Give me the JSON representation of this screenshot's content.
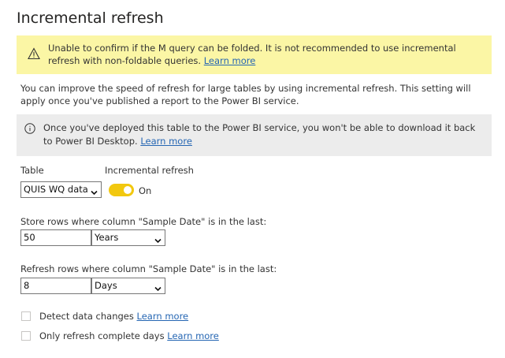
{
  "panel": {
    "title": "Incremental refresh"
  },
  "warning": {
    "text": "Unable to confirm if the M query can be folded. It is not recommended to use incremental refresh with non-foldable queries.",
    "link": "Learn more",
    "icon": "warning-icon"
  },
  "description": "You can improve the speed of refresh for large tables by using incremental refresh. This setting will apply once you've published a report to the Power BI service.",
  "info": {
    "text": "Once you've deployed this table to the Power BI service, you won't be able to download it back to Power BI Desktop.",
    "link": "Learn more",
    "icon": "info-icon"
  },
  "table": {
    "label": "Table",
    "value": "QUIS WQ data"
  },
  "incremental": {
    "label": "Incremental refresh",
    "state": "On",
    "enabled": true,
    "accent": "#f2c80f"
  },
  "store": {
    "label": "Store rows where column \"Sample Date\" is in the last:",
    "value": "50",
    "unit": "Years"
  },
  "refresh": {
    "label": "Refresh rows where column \"Sample Date\" is in the last:",
    "value": "8",
    "unit": "Days"
  },
  "detect": {
    "label": "Detect data changes",
    "link": "Learn more",
    "checked": false
  },
  "complete": {
    "label": "Only refresh complete days",
    "link": "Learn more",
    "checked": false
  }
}
